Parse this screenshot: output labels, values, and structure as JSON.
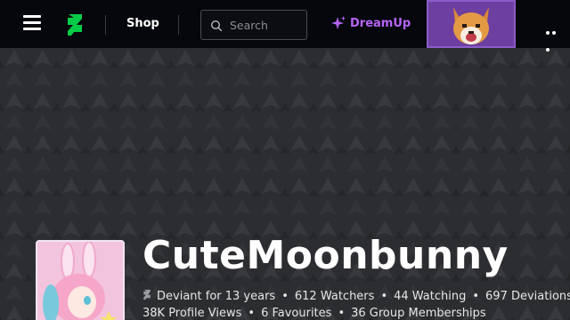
{
  "header": {
    "menu_icon": "hamburger-menu-icon",
    "logo_icon": "deviantart-logo-icon",
    "shop_label": "Shop",
    "search": {
      "placeholder": "Search",
      "value": ""
    },
    "dreamup_label": "DreamUp",
    "dreamup_icon": "sparkle-icon",
    "more_icon": "more-dots-icon"
  },
  "profile": {
    "username": "CuteMoonbunny",
    "deviant_for": "Deviant for 13 years",
    "watchers": "612 Watchers",
    "watching": "44 Watching",
    "deviations": "697 Deviations",
    "profile_views": "38K Profile Views",
    "favourites": "6 Favourites",
    "group_memberships": "36 Group Memberships"
  },
  "colors": {
    "topbar_bg": "#06070d",
    "page_bg": "#2c2d30",
    "logo_green": "#05cc47",
    "dreamup_purple": "#b565f5"
  }
}
